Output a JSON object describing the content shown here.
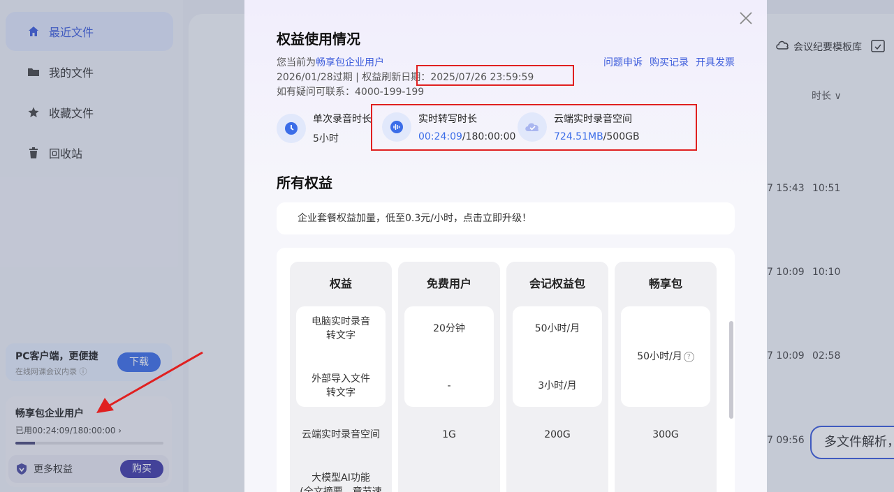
{
  "sidebar": {
    "items": [
      {
        "label": "最近文件",
        "icon": "home-icon"
      },
      {
        "label": "我的文件",
        "icon": "folder-icon"
      },
      {
        "label": "收藏文件",
        "icon": "star-icon"
      },
      {
        "label": "回收站",
        "icon": "trash-icon"
      }
    ],
    "pc_card": {
      "title": "PC客户端，更便捷",
      "subtitle": "在线网课会议内录",
      "download_label": "下载"
    },
    "vip_card": {
      "title": "畅享包企业用户",
      "used": "已用00:24:09/180:00:00 ›",
      "usage_fraction": 0.134,
      "more_label": "更多权益",
      "buy_label": "购买"
    }
  },
  "background": {
    "template_label": "会议纪要模板库",
    "duration_header": "时长 ∨",
    "rows": [
      {
        "date": "7 15:43",
        "duration": "10:51"
      },
      {
        "date": "7 10:09",
        "duration": "10:10"
      },
      {
        "date": "7 10:09",
        "duration": "02:58"
      },
      {
        "date": "7 09:56",
        "duration": ""
      }
    ],
    "multi_file_label": "多文件解析，"
  },
  "modal": {
    "title": "权益使用情况",
    "current_prefix": "您当前为",
    "current_plan": "畅享包企业用户",
    "expiry_line": "2026/01/28过期 | 权益刷新日期：",
    "refresh_date": "2025/07/26 23:59:59",
    "contact_line": "如有疑问可联系：4000-199-199",
    "links": [
      "问题申诉",
      "购买记录",
      "开具发票"
    ],
    "stats": [
      {
        "label": "单次录音时长",
        "value": "5小时",
        "icon": "clock-icon"
      },
      {
        "label": "实时转写时长",
        "value_used": "00:24:09",
        "value_total": "/180:00:00",
        "icon": "audio-wave-icon"
      },
      {
        "label": "云端实时录音空间",
        "value_used": "724.51MB",
        "value_total": "/500GB",
        "icon": "cloud-icon"
      }
    ],
    "section_title": "所有权益",
    "promo": "企业套餐权益加量，低至0.3元/小时，点击立即升级！",
    "table": {
      "headers": [
        "权益",
        "免费用户",
        "会记权益包",
        "畅享包"
      ],
      "row1": {
        "benefit_a": "电脑实时录音\n转文字",
        "benefit_b": "外部导入文件\n转文字",
        "free_a": "20分钟",
        "free_b": "-",
        "pack_a": "50小时/月",
        "pack_b": "3小时/月",
        "enjoy": "50小时/月"
      },
      "row2": {
        "benefit": "云端实时录音空间",
        "free": "1G",
        "pack": "200G",
        "enjoy": "300G"
      },
      "row3": {
        "benefit": "大模型AI功能\n(全文摘要、章节速"
      }
    }
  }
}
